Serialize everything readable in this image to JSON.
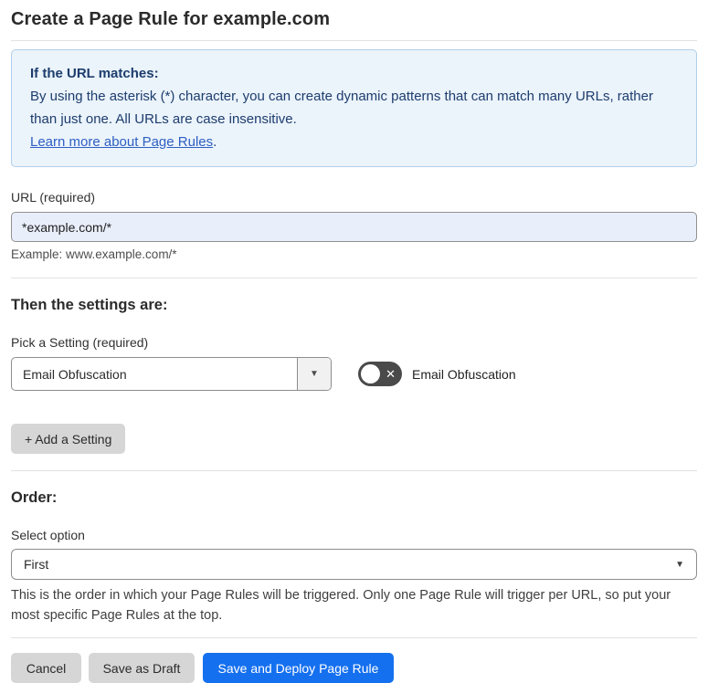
{
  "page": {
    "title": "Create a Page Rule for example.com"
  },
  "info_box": {
    "heading": "If the URL matches:",
    "body": "By using the asterisk (*) character, you can create dynamic patterns that can match many URLs, rather than just one. All URLs are case insensitive.",
    "link_label": "Learn more about Page Rules",
    "link_suffix": "."
  },
  "url_section": {
    "label": "URL (required)",
    "value": "*example.com/*",
    "example": "Example: www.example.com/*"
  },
  "settings_section": {
    "heading": "Then the settings are:",
    "picker_label": "Pick a Setting (required)",
    "picker_value": "Email Obfuscation",
    "toggle_label": "Email Obfuscation",
    "toggle_state": "off",
    "add_setting_label": "+ Add a Setting"
  },
  "order_section": {
    "heading": "Order:",
    "select_label": "Select option",
    "select_value": "First",
    "helper": "This is the order in which your Page Rules will be triggered. Only one Page Rule will trigger per URL, so put your most specific Page Rules at the top."
  },
  "footer": {
    "cancel_label": "Cancel",
    "save_draft_label": "Save as Draft",
    "save_deploy_label": "Save and Deploy Page Rule"
  },
  "colors": {
    "accent_blue": "#1570ef",
    "info_bg": "#ebf3fb",
    "info_border": "#b0cfea",
    "info_text": "#1d3d6d",
    "link_blue": "#2d5fc2",
    "input_bg": "#e9eefb",
    "toggle_bg": "#4a4a4a",
    "button_gray": "#d6d6d6"
  },
  "icons": {
    "dropdown_caret": "▼",
    "toggle_x": "✕"
  }
}
